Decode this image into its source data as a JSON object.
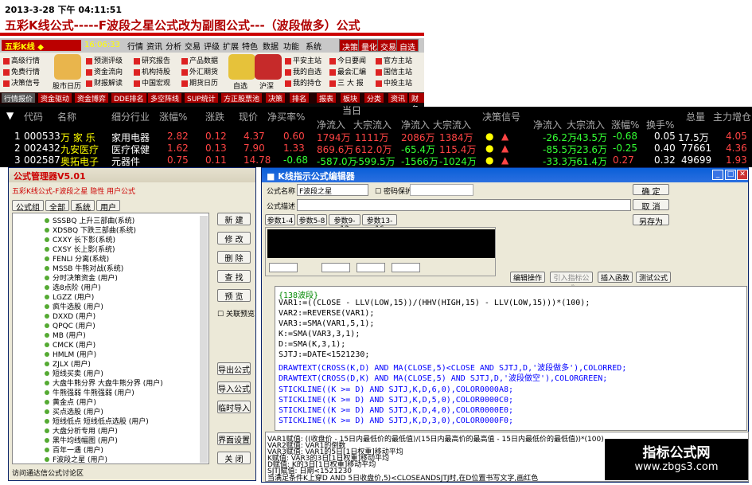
{
  "header": {
    "date": "2013-3-28 下午 04:11:51",
    "title": "五彩K线公式-----F波段之星公式改为副图公式---（波段做多）公式"
  },
  "app": {
    "logo": "五彩K线 ◆",
    "clock": "16:06:33",
    "menu": [
      "行情",
      "资讯",
      "分析",
      "交易",
      "评级",
      "扩展",
      "特色",
      "数据",
      "功能",
      "系统"
    ],
    "menu_right": [
      "决策",
      "量化",
      "交易",
      "自选"
    ],
    "icon_items": [
      "高级行情",
      "预测评级",
      "研究报告",
      "产品数据",
      "免费行情",
      "资金流向",
      "机构持股",
      "外汇期货",
      "决策信号",
      "财报解读",
      "中国宏观",
      "期货日历",
      "平安主站",
      "今日要闻",
      "官方主站",
      "我的自选",
      "最会汇编",
      "国信主站",
      "我的持仓",
      "三 大 报",
      "中投主站"
    ],
    "big_icons": [
      "股市日历",
      "自选",
      "沪深"
    ],
    "tabs": [
      "行情报价",
      "资金驱动",
      "资金博弈",
      "DDE排名",
      "多空阵线",
      "SUP统计",
      "方正股票池",
      "决策",
      "排名",
      "报表",
      "板块",
      "分类",
      "资讯",
      "财务"
    ]
  },
  "grid": {
    "headers": [
      "代码",
      "名称",
      "细分行业",
      "涨幅%",
      "涨跌",
      "现价",
      "净买率%",
      "净流入",
      "大宗流入",
      "净流入",
      "大宗流入",
      "决策信号",
      "净流入",
      "大宗流入",
      "涨幅%",
      "换手%",
      "总量",
      "主力增仓"
    ],
    "group_label": "当日",
    "rows": [
      {
        "no": "1",
        "code": "000533",
        "name": "万 家 乐",
        "industry": "家用电器",
        "pct": "2.82",
        "chg": "0.12",
        "price": "4.37",
        "net_rate": "0.60",
        "inflow1": "1794万",
        "big1": "1111万",
        "inflow2": "2086万",
        "big2": "1384万",
        "inflow3": "-26.2万",
        "big3": "-43.5万",
        "pct2": "-0.68",
        "turn": "0.05",
        "vol": "17.5万",
        "last": "4.05"
      },
      {
        "no": "2",
        "code": "002432",
        "name": "九安医疗",
        "industry": "医疗保健",
        "pct": "1.62",
        "chg": "0.13",
        "price": "7.90",
        "net_rate": "1.33",
        "inflow1": "869.6万",
        "big1": "612.0万",
        "inflow2": "-65.4万",
        "big2": "115.4万",
        "inflow3": "-85.5万",
        "big3": "-23.6万",
        "pct2": "-0.25",
        "turn": "0.40",
        "vol": "77661",
        "last": "4.36"
      },
      {
        "no": "3",
        "code": "002587",
        "name": "奥拓电子",
        "industry": "元器件",
        "pct": "0.75",
        "chg": "0.11",
        "price": "14.78",
        "net_rate": "-0.68",
        "inflow1": "-587.0万",
        "big1": "-599.5万",
        "inflow2": "-1566万",
        "big2": "-1024万",
        "inflow3": "-33.3万",
        "big3": "-61.4万",
        "pct2": "0.27",
        "turn": "0.32",
        "vol": "49699",
        "last": "1.93"
      }
    ]
  },
  "manager": {
    "title": "公式管理器V5.01",
    "breadcrumb": "五彩K线公式-F波段之星 隐性 用户公式",
    "tabs": [
      "公式组",
      "全部",
      "系统",
      "用户"
    ],
    "items": [
      "SSSBQ 上升三部曲(系统)",
      "XDSBQ 下跌三部曲(系统)",
      "CXXY 长下影(系统)",
      "CXSY 长上影(系统)",
      "FENLI 分离(系统)",
      "MSSB 牛熊对战(系统)",
      "分时决策资金 (用户)",
      "选8点阶 (用户)",
      "LGZZ (用户)",
      "疯牛选股 (用户)",
      "DXXD (用户)",
      "QPQC (用户)",
      "MB (用户)",
      "CMCK (用户)",
      "HMLM (用户)",
      "ZJLX (用户)",
      "短线买卖 (用户)",
      "大盘牛熊分界 大盘牛熊分界 (用户)",
      "牛熊强弱 牛熊强弱 (用户)",
      "黄金点 (用户)",
      "买点选股 (用户)",
      "短线低点 短线低点选股 (用户)",
      "大盘分析专用 (用户)",
      "黑牛均线幅图 (用户)",
      "百年一遇 (用户)",
      "F波段之星 (用户)"
    ],
    "buttons": [
      "新 建",
      "修 改",
      "删 除",
      "查 找",
      "预 览",
      "导出公式",
      "导入公式",
      "临时导入",
      "界面设置",
      "关 闭"
    ],
    "checkbox_label": "关联预览",
    "footer": "访问通达信公式讨论区"
  },
  "editor": {
    "title": "K线指示公式编辑器",
    "name_label": "公式名称",
    "name_value": "F波段之星",
    "pwd_label": "密码保护",
    "desc_label": "公式描述",
    "param_tabs": [
      "参数1-4",
      "参数5-8",
      "参数9-12",
      "参数13-16"
    ],
    "buttons_right": [
      "确 定",
      "取 消",
      "另存为"
    ],
    "tool_buttons": [
      "编辑操作",
      "引入指标公式",
      "插入函数",
      "测试公式"
    ],
    "code_lines": [
      "{138波段}",
      "VAR1:=((CLOSE - LLV(LOW,15))/(HHV(HIGH,15) - LLV(LOW,15)))*(100);",
      "VAR2:=REVERSE(VAR1);",
      "VAR3:=SMA(VAR1,5,1);",
      "K:=SMA(VAR3,3,1);",
      "D:=SMA(K,3,1);",
      "SJTJ:=DATE<1521230;",
      "DRAWTEXT(CROSS(K,D) AND MA(CLOSE,5)<CLOSE AND SJTJ,D,'波段做多'),COLORRED;",
      "DRAWTEXT(CROSS(D,K) AND MA(CLOSE,5) AND SJTJ,D,'波段做空'),COLORGREEN;",
      "",
      "STICKLINE((K >= D) AND SJTJ,K,D,6,0),COLOR0000A8;",
      "STICKLINE((K >= D) AND SJTJ,K,D,5,0),COLOR0000C0;",
      "STICKLINE((K >= D) AND SJTJ,K,D,4,0),COLOR0000E0;",
      "STICKLINE((K >= D) AND SJTJ,K,D,3,0),COLOR0000F0;"
    ],
    "desc_lines": [
      "VAR1赋值: ((收盘价 - 15日内最低价的最低值)/(15日内最高价的最高值 - 15日内最低价的最低值))*(100)",
      "VAR2赋值: VAR1的倒数",
      "VAR3赋值: VAR1的5日[1日权重]移动平均",
      "K赋值: VAR3的3日[1日权重]移动平均",
      "D赋值: K的3日[1日权重]移动平均",
      "SJTJ赋值: 日期<1521230",
      "当满足条件K上穿D AND 5日收盘价,5)<CLOSEANDSJTJ时,在D位置书写文字,画红色"
    ]
  },
  "watermark": {
    "line1": "指标公式网",
    "line2": "www.zbgs3.com"
  }
}
